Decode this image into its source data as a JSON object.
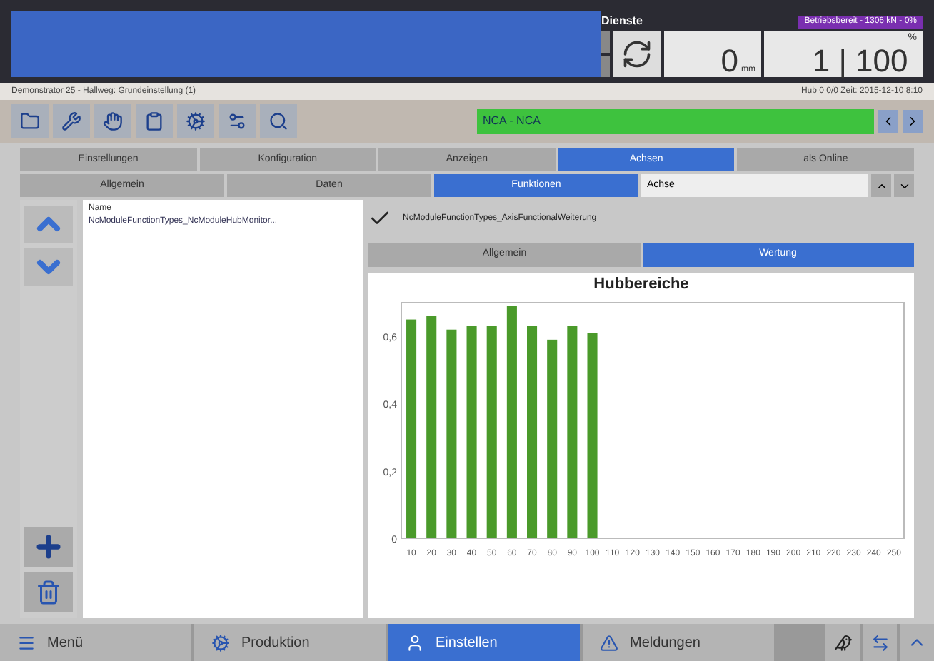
{
  "header": {
    "panel_label": "Dienste",
    "mode_badge": "Betriebsbereit - 1306 kN - 0%",
    "counter": "0",
    "counter_unit": "mm",
    "stroke_count": "1",
    "stroke_separator": "|",
    "stroke_total": "100",
    "stroke_unit": "%"
  },
  "status_line": {
    "left": "Demonstrator 25 - Hallweg: Grundeinstellung (1)",
    "right": "Hub 0 0/0 Zeit: 2015-12-10 8:10"
  },
  "toolbar": {
    "machine": "NCA - NCA"
  },
  "main_tabs": [
    {
      "label": "Einstellungen",
      "selected": false
    },
    {
      "label": "Konfiguration",
      "selected": false
    },
    {
      "label": "Anzeigen",
      "selected": false
    },
    {
      "label": "Achsen",
      "selected": true
    },
    {
      "label": "als Online",
      "selected": false
    }
  ],
  "sub_tabs": [
    {
      "label": "Allgemein",
      "selected": false
    },
    {
      "label": "Daten",
      "selected": false
    },
    {
      "label": "Funktionen",
      "selected": true
    }
  ],
  "axis_select": {
    "value": "Achse"
  },
  "list": {
    "header": "Name",
    "items": [
      {
        "label": "NcModuleFunctionTypes_NcModuleHubMonitor...",
        "selected": false
      }
    ]
  },
  "function": {
    "label": "NcModuleFunctionTypes_AxisFunctionalWeiterung",
    "checked": true
  },
  "detail_tabs": [
    {
      "label": "Allgemein",
      "selected": false
    },
    {
      "label": "Wertung",
      "selected": true
    }
  ],
  "chart_data": {
    "type": "bar",
    "title": "Hubbereiche",
    "categories": [
      "10",
      "20",
      "30",
      "40",
      "50",
      "60",
      "70",
      "80",
      "90",
      "100",
      "110",
      "120",
      "130",
      "140",
      "150",
      "160",
      "170",
      "180",
      "190",
      "200",
      "210",
      "220",
      "230",
      "240",
      "250"
    ],
    "values": [
      0.65,
      0.66,
      0.62,
      0.63,
      0.63,
      0.69,
      0.63,
      0.59,
      0.63,
      0.61,
      null,
      null,
      null,
      null,
      null,
      null,
      null,
      null,
      null,
      null,
      null,
      null,
      null,
      null,
      null
    ],
    "ylim": [
      0,
      0.7
    ],
    "yticks": [
      {
        "value": 0,
        "label": "0"
      },
      {
        "value": 0.2,
        "label": "0,2"
      },
      {
        "value": 0.4,
        "label": "0,4"
      },
      {
        "value": 0.6,
        "label": "0,6"
      }
    ]
  },
  "bottom_nav": [
    {
      "label": "Menü",
      "kind": "menu",
      "selected": false
    },
    {
      "label": "Produktion",
      "kind": "production",
      "selected": false
    },
    {
      "label": "Einstellen",
      "kind": "setup",
      "selected": true
    },
    {
      "label": "Meldungen",
      "kind": "messages",
      "selected": false
    }
  ]
}
